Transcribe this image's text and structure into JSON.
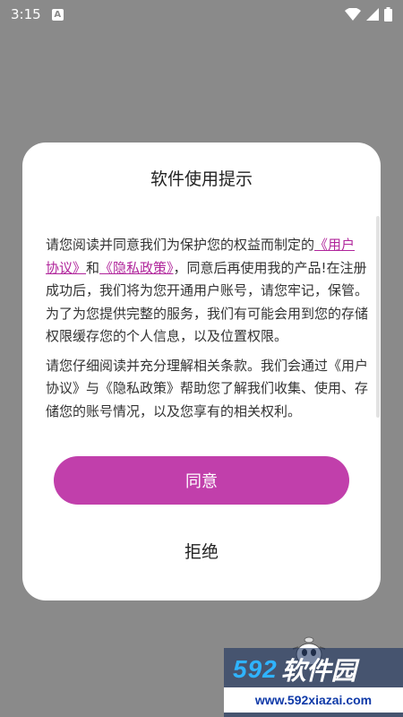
{
  "status_bar": {
    "time": "3:15",
    "notification_icon_letter": "A"
  },
  "dialog": {
    "title": "软件使用提示",
    "paragraph1": {
      "intro": "请您阅读并同意我们为保护您的权益而制定的",
      "link_user_agreement": "《用户协议》",
      "and": "和",
      "link_privacy_policy": "《隐私政策》",
      "rest": "，同意后再使用我的产品!在注册成功后，我们将为您开通用户账号，请您牢记，保管。为了为您提供完整的服务，我们有可能会用到您的存储权限缓存您的个人信息，以及位置权限。"
    },
    "paragraph2": "请您仔细阅读并充分理解相关条款。我们会通过《用户协议》与《隐私政策》帮助您了解我们收集、使用、存储您的账号情况，以及您享有的相关权利。",
    "agree_label": "同意",
    "reject_label": "拒绝"
  },
  "watermark": {
    "number": "592",
    "brand": "软件园",
    "url": "www.592xiazai.com"
  },
  "colors": {
    "accent": "#c13fab",
    "link": "#b0259b",
    "overlay": "#8a8a8a"
  }
}
